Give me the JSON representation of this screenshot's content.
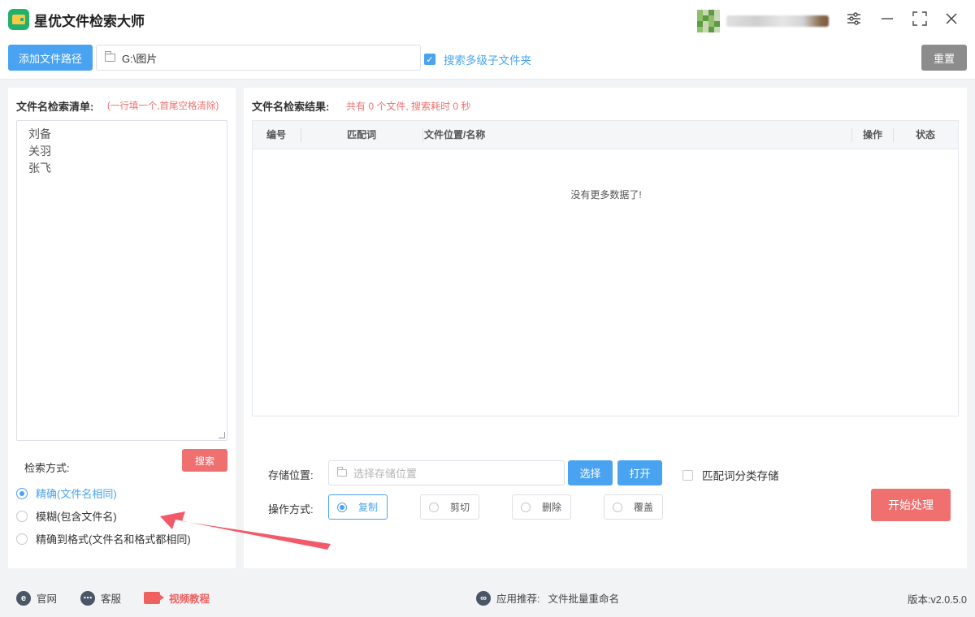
{
  "app": {
    "title": "星优文件检索大师"
  },
  "toolbar": {
    "add_path_label": "添加文件路径",
    "path_value": "G:\\图片",
    "subfolder_label": "搜索多级子文件夹",
    "subfolder_checked": true,
    "reset_label": "重置"
  },
  "left": {
    "title": "文件名检索清单:",
    "hint": "(一行填一个,首尾空格清除)",
    "names": [
      "刘备",
      "关羽",
      "张飞"
    ],
    "search_mode_label": "检索方式:",
    "search_button": "搜索",
    "modes": [
      {
        "label": "精确(文件名相同)",
        "selected": true
      },
      {
        "label": "模糊(包含文件名)",
        "selected": false
      },
      {
        "label": "精确到格式(文件名和格式都相同)",
        "selected": false
      }
    ]
  },
  "right": {
    "title": "文件名检索结果:",
    "stat": "共有 0 个文件, 搜索耗时 0 秒",
    "columns": [
      "编号",
      "匹配词",
      "文件位置/名称",
      "操作",
      "状态"
    ],
    "empty_message": "没有更多数据了!",
    "store_label": "存储位置:",
    "store_placeholder": "选择存储位置",
    "choose_button": "选择",
    "open_button": "打开",
    "classify_label": "匹配词分类存储",
    "op_label": "操作方式:",
    "operations": [
      {
        "label": "复制",
        "selected": true
      },
      {
        "label": "剪切",
        "selected": false
      },
      {
        "label": "删除",
        "selected": false
      },
      {
        "label": "覆盖",
        "selected": false
      }
    ],
    "start_button": "开始处理"
  },
  "footer": {
    "website": "官网",
    "service": "客服",
    "video": "视频教程",
    "recommend_label": "应用推荐:",
    "recommend_app": "文件批量重命名",
    "version": "版本:v2.0.5.0"
  },
  "colors": {
    "accent": "#4aa3f0",
    "danger": "#f07070",
    "gray_button": "#8c8c8c",
    "logo": "#20b26b"
  },
  "icons": [
    "app-logo-icon",
    "settings-icon",
    "minimize-icon",
    "maximize-icon",
    "close-icon",
    "folder-icon",
    "check-icon",
    "ie-icon",
    "chat-icon",
    "video-icon",
    "link-icon"
  ]
}
